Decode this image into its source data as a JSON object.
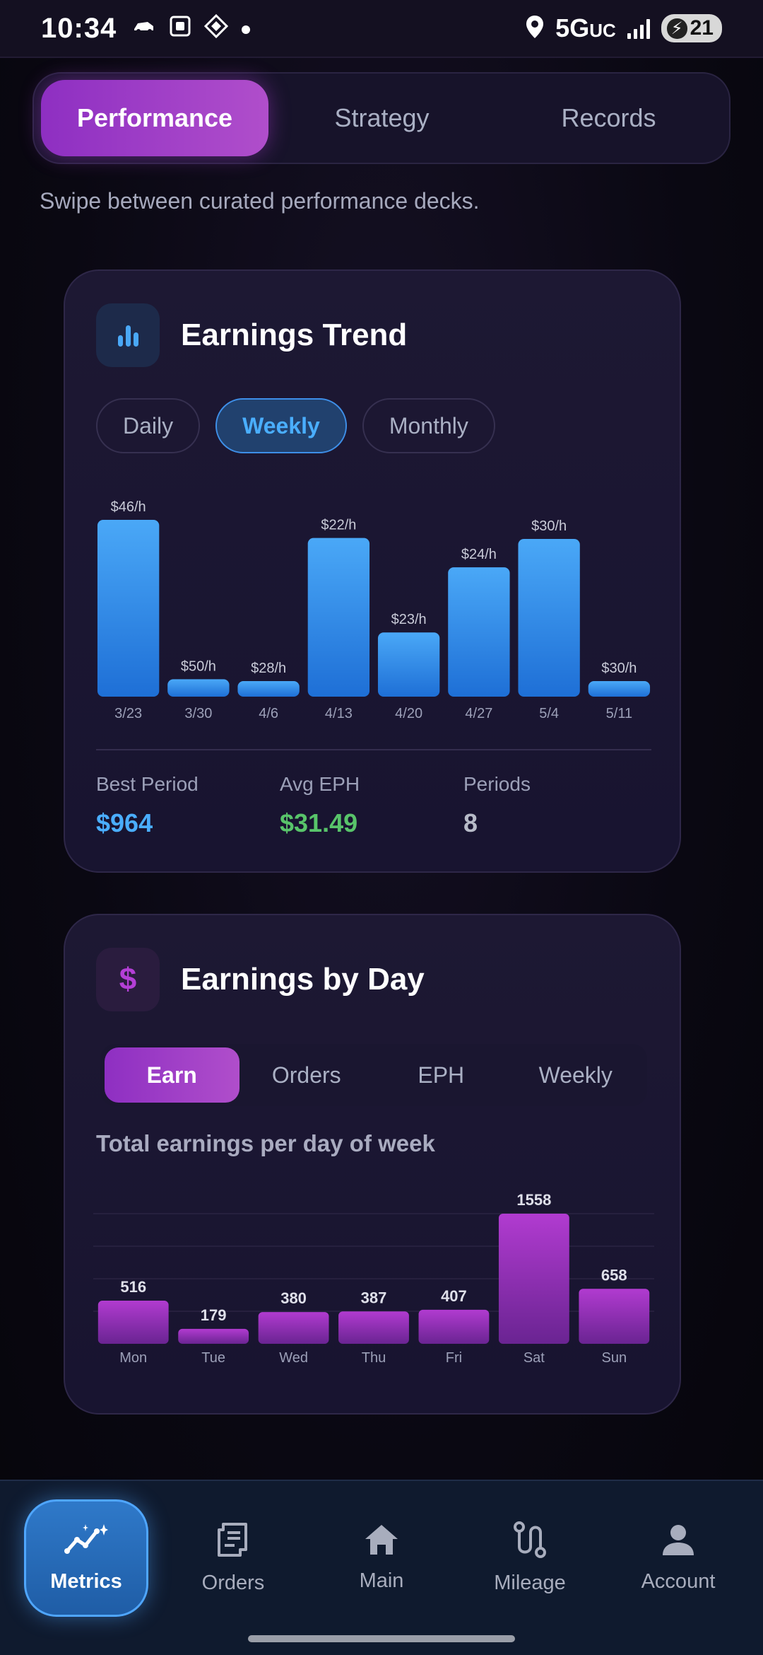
{
  "status_bar": {
    "time": "10:34",
    "network": "5G",
    "network_suffix": "UC",
    "battery": "21"
  },
  "top_tabs": [
    {
      "label": "Performance",
      "active": true
    },
    {
      "label": "Strategy",
      "active": false
    },
    {
      "label": "Records",
      "active": false
    }
  ],
  "subtitle": "Swipe between curated performance decks.",
  "earnings_trend": {
    "title": "Earnings Trend",
    "icon": "bar-chart-icon",
    "filters": [
      {
        "label": "Daily",
        "active": false
      },
      {
        "label": "Weekly",
        "active": true
      },
      {
        "label": "Monthly",
        "active": false
      }
    ],
    "stats": {
      "best_period_label": "Best Period",
      "best_period_value": "$964",
      "avg_eph_label": "Avg EPH",
      "avg_eph_value": "$31.49",
      "periods_label": "Periods",
      "periods_value": "8"
    }
  },
  "earnings_by_day": {
    "title": "Earnings by Day",
    "icon": "dollar-icon",
    "tabs": [
      {
        "label": "Earn",
        "active": true
      },
      {
        "label": "Orders",
        "active": false
      },
      {
        "label": "EPH",
        "active": false
      },
      {
        "label": "Weekly",
        "active": false
      }
    ],
    "caption": "Total earnings per day of week"
  },
  "chart_data": [
    {
      "type": "bar",
      "categories": [
        "3/23",
        "3/30",
        "4/6",
        "4/13",
        "4/20",
        "4/27",
        "5/4",
        "5/11"
      ],
      "values": [
        964,
        95,
        70,
        865,
        350,
        705,
        860,
        80
      ],
      "data_labels": [
        "$46/h",
        "$50/h",
        "$28/h",
        "$22/h",
        "$23/h",
        "$24/h",
        "$30/h",
        "$30/h"
      ],
      "title": "",
      "xlabel": "",
      "ylabel": "",
      "ylim": [
        0,
        964
      ],
      "grid": false,
      "colors": {
        "top": "#4aa8f7",
        "bottom": "#1e6fd6"
      }
    },
    {
      "type": "bar",
      "categories": [
        "Mon",
        "Tue",
        "Wed",
        "Thu",
        "Fri",
        "Sat",
        "Sun"
      ],
      "values": [
        516,
        179,
        380,
        387,
        407,
        1558,
        658
      ],
      "data_labels": [
        "516",
        "179",
        "380",
        "387",
        "407",
        "1558",
        "658"
      ],
      "title": "",
      "xlabel": "",
      "ylabel": "",
      "ylim": [
        0,
        1558
      ],
      "grid": true,
      "colors": {
        "top": "#b13bd0",
        "bottom": "#6a2492"
      }
    }
  ],
  "bottom_nav": [
    {
      "label": "Metrics",
      "icon": "metrics-icon",
      "active": true
    },
    {
      "label": "Orders",
      "icon": "receipt-icon",
      "active": false
    },
    {
      "label": "Main",
      "icon": "home-icon",
      "active": false
    },
    {
      "label": "Mileage",
      "icon": "route-icon",
      "active": false
    },
    {
      "label": "Account",
      "icon": "person-icon",
      "active": false
    }
  ],
  "colors": {
    "accent_purple": "#a03fc9",
    "accent_blue": "#3e9bff",
    "best_period": "#4aaeff",
    "avg_eph": "#58c46a",
    "periods": "#b7bbc8"
  }
}
